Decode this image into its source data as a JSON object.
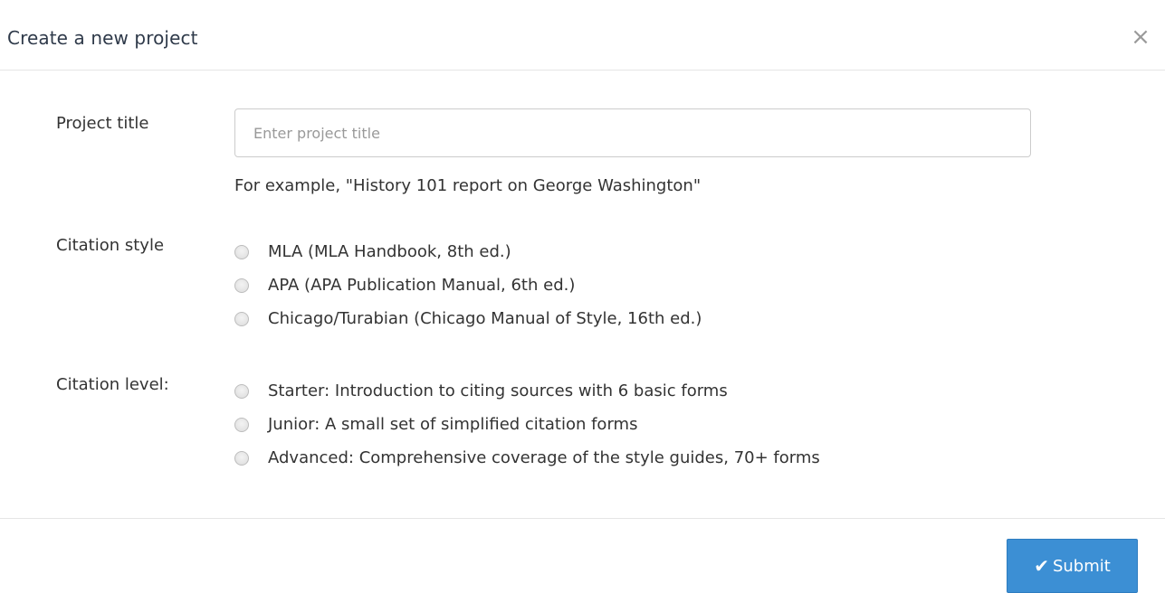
{
  "modal": {
    "title": "Create a new project",
    "close_glyph": "×"
  },
  "form": {
    "project_title": {
      "label": "Project title",
      "value": "",
      "placeholder": "Enter project title",
      "help_text": "For example, \"History 101 report on George Washington\""
    },
    "citation_style": {
      "label": "Citation style",
      "selected": null,
      "options": [
        {
          "label": "MLA (MLA Handbook, 8th ed.)"
        },
        {
          "label": "APA (APA Publication Manual, 6th ed.)"
        },
        {
          "label": "Chicago/Turabian (Chicago Manual of Style, 16th ed.)"
        }
      ]
    },
    "citation_level": {
      "label": "Citation level:",
      "selected": null,
      "options": [
        {
          "label": "Starter: Introduction to citing sources with 6 basic forms"
        },
        {
          "label": "Junior: A small set of simplified citation forms"
        },
        {
          "label": "Advanced: Comprehensive coverage of the style guides, 70+ forms"
        }
      ]
    }
  },
  "footer": {
    "submit_label": "Submit",
    "submit_icon": "check-icon",
    "submit_glyph": "✔"
  },
  "colors": {
    "primary_button": "#3c8fd4",
    "title_text": "#2f3a4a",
    "divider": "#e5e5e5"
  }
}
